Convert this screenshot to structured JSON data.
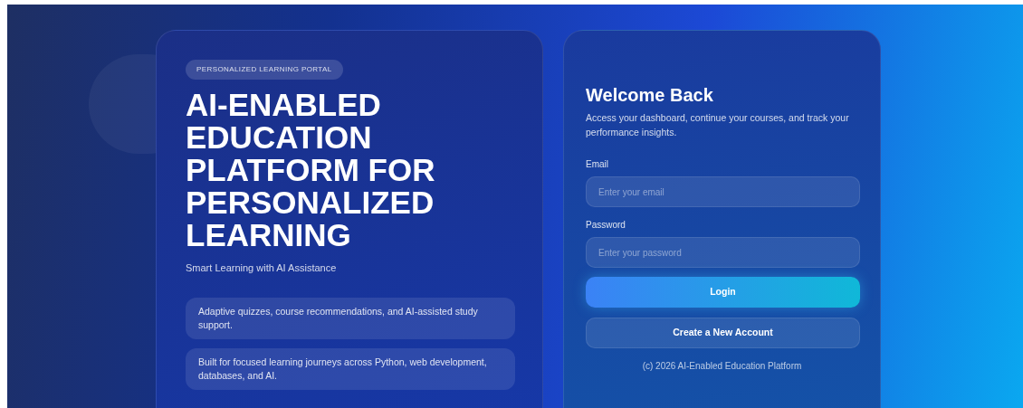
{
  "hero": {
    "badge": "PERSONALIZED LEARNING PORTAL",
    "title": "AI-ENABLED EDUCATION PLATFORM FOR PERSONALIZED LEARNING",
    "subtitle": "Smart Learning with AI Assistance",
    "features": [
      "Adaptive quizzes, course recommendations, and AI-assisted study support.",
      "Built for focused learning journeys across Python, web development, databases, and AI."
    ]
  },
  "login": {
    "title": "Welcome Back",
    "description": "Access your dashboard, continue your courses, and track your performance insights.",
    "fields": [
      {
        "label": "Email",
        "placeholder": "Enter your email"
      },
      {
        "label": "Password",
        "placeholder": "Enter your password"
      }
    ],
    "buttons": [
      {
        "label": "Login",
        "kind": "primary"
      },
      {
        "label": "Create a New Account",
        "kind": "secondary"
      }
    ],
    "footer": "(c) 2026 AI-Enabled Education Platform"
  }
}
